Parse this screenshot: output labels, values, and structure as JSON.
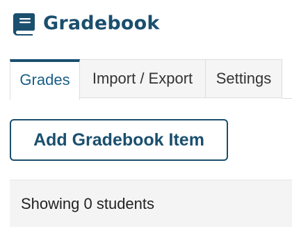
{
  "header": {
    "title": "Gradebook",
    "icon": "book-icon",
    "accent_color": "#1a4f6e"
  },
  "tabs": [
    {
      "label": "Grades",
      "active": true
    },
    {
      "label": "Import / Export",
      "active": false
    },
    {
      "label": "Settings",
      "active": false
    }
  ],
  "toolbar": {
    "add_item_label": "Add Gradebook Item"
  },
  "status": {
    "text": "Showing 0 students"
  }
}
